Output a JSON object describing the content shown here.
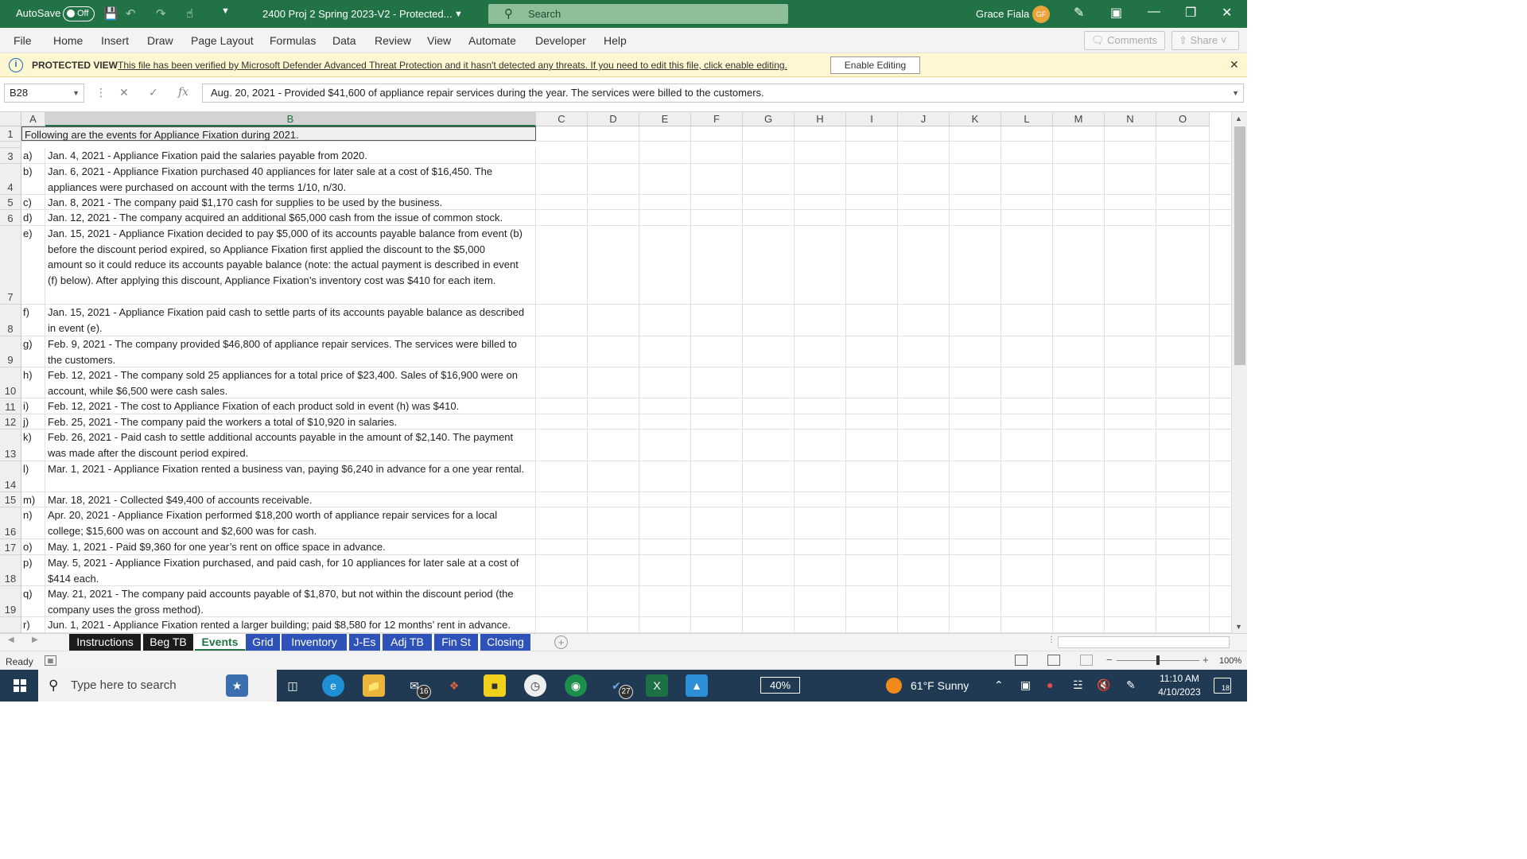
{
  "titlebar": {
    "autosave_label": "AutoSave",
    "autosave_state": "Off",
    "doc_title": "2400 Proj 2 Spring 2023-V2  -  Protected...",
    "search_placeholder": "Search",
    "user_name": "Grace Fiala",
    "user_initials": "GF",
    "accent": "#217346"
  },
  "menu": {
    "tabs": [
      "File",
      "Home",
      "Insert",
      "Draw",
      "Page Layout",
      "Formulas",
      "Data",
      "Review",
      "View",
      "Automate",
      "Developer",
      "Help"
    ],
    "comments": "Comments",
    "share": "Share"
  },
  "protected": {
    "label": "PROTECTED VIEW",
    "message": "This file has been verified by Microsoft Defender Advanced Threat Protection and it hasn't detected any threats. If you need to edit this file, click enable editing.",
    "enable_button": "Enable Editing"
  },
  "formula_bar": {
    "name_box": "B28",
    "fx": "fx",
    "content": "Aug. 20, 2021 - Provided $41,600 of appliance repair services during the year. The services were billed to the customers."
  },
  "columns": [
    "A",
    "B",
    "C",
    "D",
    "E",
    "F",
    "G",
    "H",
    "I",
    "J",
    "K",
    "L",
    "M",
    "N",
    "O"
  ],
  "rows": [
    {
      "num": "1",
      "a": "",
      "b": [
        "Following are the events for Appliance Fixation during 2021."
      ]
    },
    {
      "num": "3",
      "a": "a)",
      "b": [
        "Jan. 4, 2021 - Appliance Fixation paid the salaries payable from 2020."
      ]
    },
    {
      "num": "4",
      "a": "b)",
      "b": [
        "Jan. 6, 2021 - Appliance Fixation purchased 40 appliances for later sale at a cost of $16,450. The",
        "appliances were purchased on account with the terms 1/10, n/30."
      ]
    },
    {
      "num": "5",
      "a": "c)",
      "b": [
        "Jan. 8, 2021 - The company paid $1,170 cash for supplies to be used by the business."
      ]
    },
    {
      "num": "6",
      "a": "d)",
      "b": [
        "Jan. 12, 2021 - The company acquired an additional $65,000 cash from the issue of common stock."
      ]
    },
    {
      "num": "7",
      "a": "e)",
      "b": [
        "Jan. 15, 2021 - Appliance Fixation decided to pay $5,000 of its accounts payable balance from event (b)",
        "before the discount period expired, so Appliance Fixation first applied the discount to the $5,000",
        "amount so it could reduce its accounts payable balance (note: the actual payment is described in event",
        "(f) below).  After applying this discount, Appliance Fixation’s inventory cost was $410 for each item."
      ]
    },
    {
      "num": "8",
      "a": "f)",
      "b": [
        "Jan. 15, 2021 - Appliance Fixation paid cash to settle parts of its accounts payable balance as described",
        "in event (e)."
      ]
    },
    {
      "num": "9",
      "a": "g)",
      "b": [
        "Feb. 9, 2021 - The company provided $46,800 of appliance repair services. The services were billed to",
        "the customers."
      ]
    },
    {
      "num": "10",
      "a": "h)",
      "b": [
        "Feb. 12, 2021 - The company sold 25 appliances for a total price of $23,400. Sales of $16,900 were on",
        "account, while $6,500 were cash sales."
      ]
    },
    {
      "num": "11",
      "a": "i)",
      "b": [
        "Feb. 12, 2021 - The cost to Appliance Fixation of each product sold in event (h) was $410."
      ]
    },
    {
      "num": "12",
      "a": "j)",
      "b": [
        "Feb. 25, 2021 - The company paid the workers a total of $10,920 in salaries."
      ]
    },
    {
      "num": "13",
      "a": "k)",
      "b": [
        "Feb. 26, 2021 - Paid cash to settle additional accounts payable in the amount of $2,140. The payment",
        "was made after the discount period expired."
      ]
    },
    {
      "num": "14",
      "a": "l)",
      "b": [
        "Mar. 1, 2021 - Appliance Fixation rented a business van, paying $6,240 in advance for a one year rental."
      ]
    },
    {
      "num": "15",
      "a": "m)",
      "b": [
        "Mar. 18, 2021 - Collected $49,400 of accounts receivable."
      ]
    },
    {
      "num": "16",
      "a": "n)",
      "b": [
        "Apr. 20, 2021 - Appliance Fixation performed $18,200 worth of appliance repair services for a local",
        "college; $15,600 was on account and $2,600 was for cash."
      ]
    },
    {
      "num": "17",
      "a": "o)",
      "b": [
        "May. 1, 2021 - Paid $9,360 for one year’s rent on office space in advance."
      ]
    },
    {
      "num": "18",
      "a": "p)",
      "b": [
        "May. 5, 2021 - Appliance Fixation purchased, and paid cash, for 10 appliances for later sale at a cost of",
        "$414 each."
      ]
    },
    {
      "num": "19",
      "a": "q)",
      "b": [
        "May. 21, 2021 - The company paid accounts payable of $1,870, but not within the discount period (the",
        "company uses the gross method)."
      ]
    },
    {
      "num": "",
      "a": "r)",
      "b": [
        "Jun. 1, 2021 - Appliance Fixation rented a larger building; paid $8,580 for 12 months’ rent in advance."
      ]
    }
  ],
  "sheets": [
    "Instructions",
    "Beg TB",
    "Events",
    "Grid",
    "Inventory",
    "J-Es",
    "Adj TB",
    "Fin St",
    "Closing"
  ],
  "active_sheet": "Events",
  "status": {
    "ready": "Ready",
    "zoom": "100%"
  },
  "taskbar": {
    "search_placeholder": "Type here to search",
    "mail_badge": "16",
    "app_badge": "27",
    "battery": "40%",
    "weather": "61°F  Sunny",
    "time": "11:10 AM",
    "date": "4/10/2023",
    "notifications": "18"
  }
}
